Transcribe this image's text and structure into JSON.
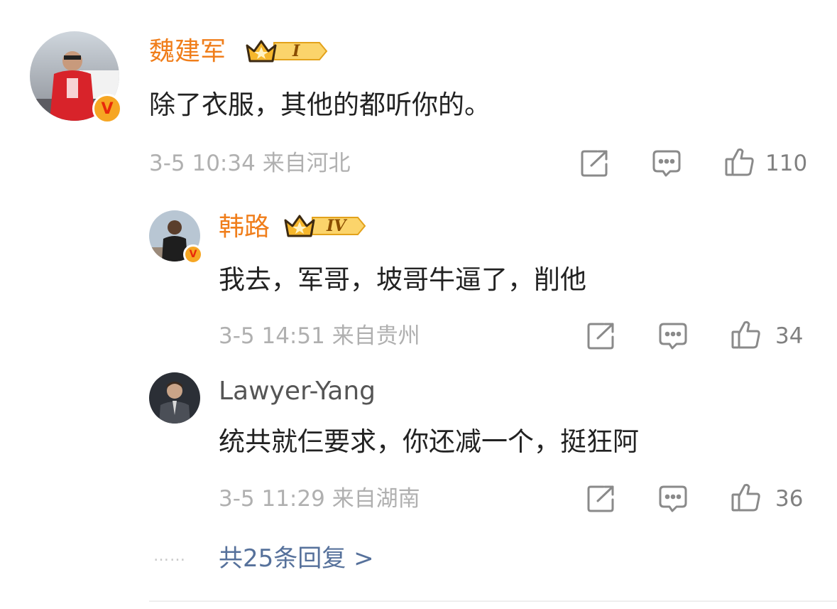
{
  "comment": {
    "name": "魏建军",
    "level": "I",
    "text": "除了衣服，其他的都听你的。",
    "time": "3-5 10:34",
    "location": "来自河北",
    "likes": "110",
    "verified_mark": "V"
  },
  "replies": [
    {
      "name": "韩路",
      "level": "IV",
      "text": "我去，军哥，坡哥牛逼了，削他",
      "time": "3-5 14:51",
      "location": "来自贵州",
      "likes": "34",
      "verified_mark": "V"
    },
    {
      "name": "Lawyer-Yang",
      "text": "统共就仨要求，你还减一个，挺狂阿",
      "time": "3-5 11:29",
      "location": "来自湖南",
      "likes": "36"
    }
  ],
  "more_replies": {
    "dots": "……",
    "label": "共25条回复 >"
  },
  "colors": {
    "vip_name": "#f07e1b",
    "link": "#56719b",
    "meta": "#b0b0b0",
    "verified": "#f6a623"
  },
  "icons": [
    "share-icon",
    "comment-icon",
    "like-icon",
    "crown-icon",
    "verified-icon"
  ]
}
